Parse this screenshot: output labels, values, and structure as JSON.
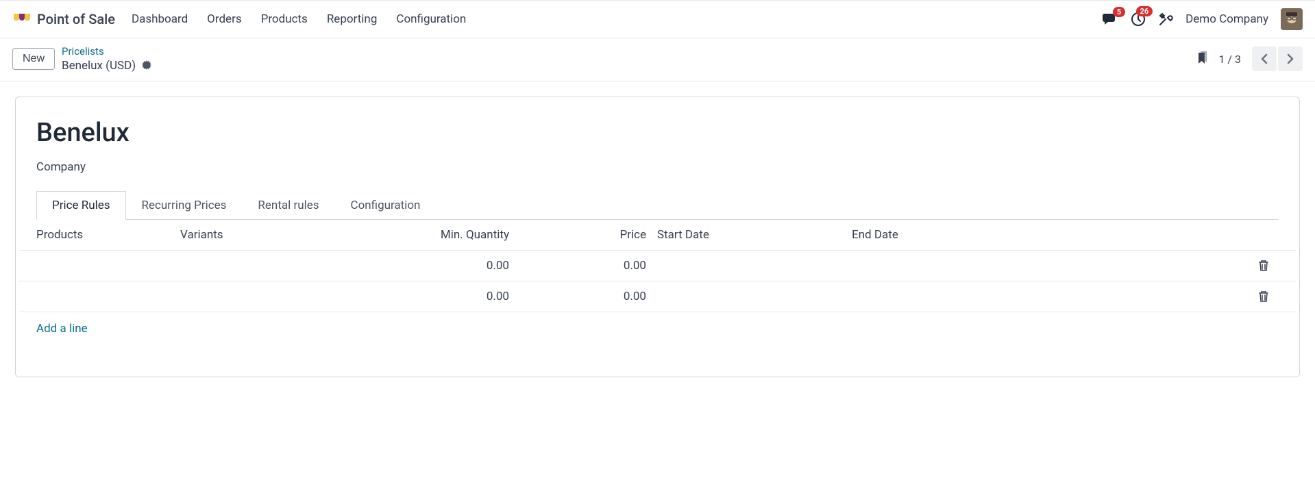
{
  "brand": "Point of Sale",
  "nav": [
    "Dashboard",
    "Orders",
    "Products",
    "Reporting",
    "Configuration"
  ],
  "message_badge": "5",
  "activity_badge": "26",
  "company": "Demo Company",
  "new_button": "New",
  "breadcrumb": {
    "link": "Pricelists",
    "current": "Benelux (USD)"
  },
  "pager": "1 / 3",
  "record": {
    "title": "Benelux",
    "company_label": "Company"
  },
  "tabs": [
    "Price Rules",
    "Recurring Prices",
    "Rental rules",
    "Configuration"
  ],
  "columns": {
    "products": "Products",
    "variants": "Variants",
    "min_qty": "Min. Quantity",
    "price": "Price",
    "start": "Start Date",
    "end": "End Date"
  },
  "rows": [
    {
      "products": "",
      "variants": "",
      "min_qty": "0.00",
      "price": "0.00",
      "start": "",
      "end": ""
    },
    {
      "products": "",
      "variants": "",
      "min_qty": "0.00",
      "price": "0.00",
      "start": "",
      "end": ""
    }
  ],
  "add_line": "Add a line"
}
